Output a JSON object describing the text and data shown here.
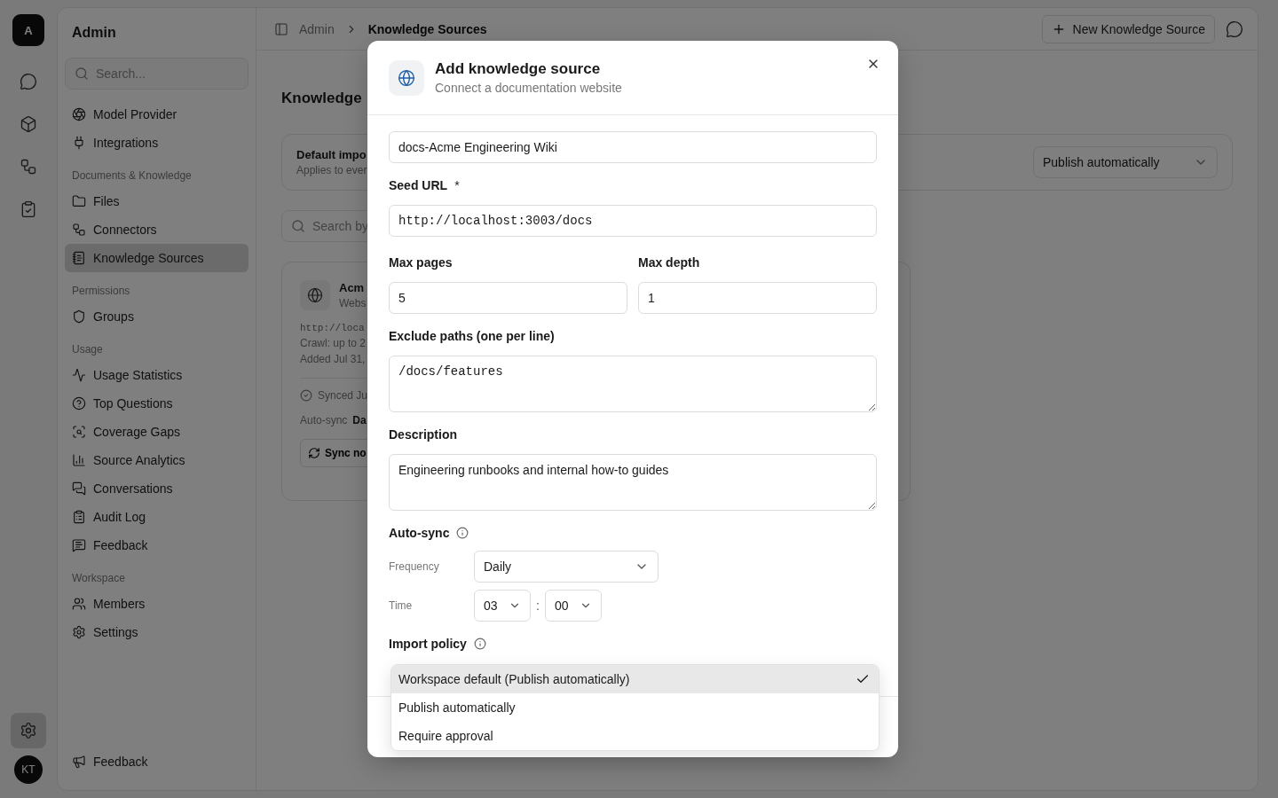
{
  "rail": {
    "logo": "A",
    "items": [
      {
        "selected": false
      },
      {
        "selected": false
      },
      {
        "selected": false
      },
      {
        "selected": false
      }
    ],
    "settings": {
      "selected": true
    },
    "avatar": "KT"
  },
  "sidebar": {
    "title": "Admin",
    "search": {
      "placeholder": "Search..."
    },
    "sections": [
      {
        "items": [
          {
            "label": "Model Provider",
            "selected": false
          },
          {
            "label": "Integrations",
            "selected": false
          }
        ]
      },
      {
        "label": "Documents & Knowledge",
        "items": [
          {
            "label": "Files",
            "selected": false
          },
          {
            "label": "Connectors",
            "selected": false
          },
          {
            "label": "Knowledge Sources",
            "selected": true
          }
        ]
      },
      {
        "label": "Permissions",
        "items": [
          {
            "label": "Groups",
            "selected": false
          }
        ]
      },
      {
        "label": "Usage",
        "items": [
          {
            "label": "Usage Statistics",
            "selected": false
          },
          {
            "label": "Top Questions",
            "selected": false
          },
          {
            "label": "Coverage Gaps",
            "selected": false
          },
          {
            "label": "Source Analytics",
            "selected": false
          },
          {
            "label": "Conversations",
            "selected": false
          },
          {
            "label": "Audit Log",
            "selected": false
          },
          {
            "label": "Feedback",
            "selected": false
          }
        ]
      },
      {
        "label": "Workspace",
        "items": [
          {
            "label": "Members",
            "selected": false
          },
          {
            "label": "Settings",
            "selected": false
          }
        ]
      }
    ],
    "footer_item": "Feedback"
  },
  "topbar": {
    "breadcrumb": [
      "Admin",
      "Knowledge Sources"
    ],
    "new_button": "New Knowledge Source"
  },
  "page": {
    "heading": "Knowledge",
    "default_card": {
      "title": "Default impo",
      "subtitle": "Applies to ever",
      "select": "Publish automatically"
    },
    "search": {
      "placeholder": "Search by"
    },
    "source_card": {
      "name": "Acm",
      "type": "Webs",
      "url": "http://loca",
      "crawl": "Crawl: up to 2",
      "added": "Added Jul 31,",
      "synced": "Synced Ju",
      "autosync_label": "Auto-sync",
      "autosync_value": "Da",
      "sync_button": "Sync no"
    }
  },
  "modal": {
    "title": "Add knowledge source",
    "subtitle": "Connect a documentation website",
    "name": {
      "value": "docs-Acme Engineering Wiki"
    },
    "seed_url": {
      "label": "Seed URL",
      "required_mark": "*",
      "value": "http://localhost:3003/docs"
    },
    "max_pages": {
      "label": "Max pages",
      "value": "5"
    },
    "max_depth": {
      "label": "Max depth",
      "value": "1"
    },
    "exclude_paths": {
      "label": "Exclude paths (one per line)",
      "value": "/docs/features"
    },
    "description": {
      "label": "Description",
      "value": "Engineering runbooks and internal how-to guides"
    },
    "auto_sync": {
      "label": "Auto-sync",
      "frequency_label": "Frequency",
      "frequency": "Daily",
      "time_label": "Time",
      "hour": "03",
      "separator": ":",
      "minute": "00"
    },
    "import_policy": {
      "label": "Import policy",
      "options": [
        {
          "label": "Workspace default (Publish automatically)",
          "selected": true
        },
        {
          "label": "Publish automatically",
          "selected": false
        },
        {
          "label": "Require approval",
          "selected": false
        }
      ]
    }
  }
}
